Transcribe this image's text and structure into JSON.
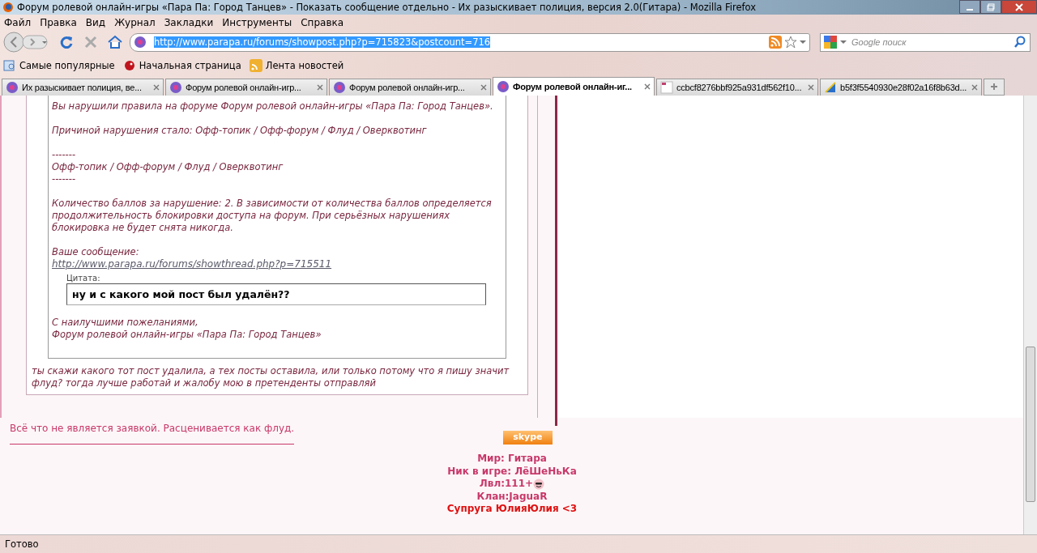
{
  "window": {
    "title": "Форум ролевой онлайн-игры «Пара Па: Город Танцев» - Показать сообщение отдельно - Их разыскивает полиция, версия 2.0(Гитара) - Mozilla Firefox"
  },
  "menu": [
    "Файл",
    "Правка",
    "Вид",
    "Журнал",
    "Закладки",
    "Инструменты",
    "Справка"
  ],
  "address": {
    "value": "http://www.parapa.ru/forums/showpost.php?p=715823&postcount=716"
  },
  "search": {
    "placeholder": "Google поиск"
  },
  "bookmarks": [
    {
      "label": "Самые популярные",
      "kind": "smart"
    },
    {
      "label": "Начальная страница",
      "kind": "home"
    },
    {
      "label": "Лента новостей",
      "kind": "feed"
    }
  ],
  "tabs": [
    {
      "label": "Их разыскивает полиция, ве...",
      "selected": false,
      "kind": "forum"
    },
    {
      "label": "Форум ролевой онлайн-игр...",
      "selected": false,
      "kind": "forum"
    },
    {
      "label": "Форум ролевой онлайн-игр...",
      "selected": false,
      "kind": "forum"
    },
    {
      "label": "Форум ролевой онлайн-иг...",
      "selected": true,
      "kind": "forum"
    },
    {
      "label": "ccbcf8276bbf925a931df562f10...",
      "selected": false,
      "kind": "image"
    },
    {
      "label": "b5f3f5540930e28f02a16f8b63d...",
      "selected": false,
      "kind": "file"
    }
  ],
  "notice": {
    "paragraphs": [
      [
        "Вы нарушили правила на форуме Форум ролевой онлайн-игры «Пара Па: Город Танцев»."
      ],
      [
        "Причиной нарушения стало: Офф-топик / Офф-форум / Флуд / Оверквотинг"
      ],
      [
        "-------",
        "Офф-топик / Офф-форум / Флуд / Оверквотинг",
        "-------"
      ],
      [
        "Количество баллов за нарушение: 2. В зависимости от количества баллов определяется продолжительность блокировки доступа на форум. При серьёзных нарушениях блокировка не будет снята никогда."
      ],
      [
        "Ваше сообщение:"
      ]
    ],
    "link": "http://www.parapa.ru/forums/showthread.php?p=715511",
    "quote_label": "Цитата:",
    "quote": "ну и с какого мой пост был удалён??",
    "closing": [
      "С наилучшими пожеланиями,",
      "Форум ролевой онлайн-игры «Пара Па: Город Танцев»"
    ]
  },
  "reply": "ты скажи какого тот пост удалила, а тех посты оставила, или только потому что я пишу значит флуд? тогда лучше работай и жалобу мою в претенденты отправляй",
  "rule": "Всё что не является заявкой. Расценивается как флуд.",
  "skype": "skype",
  "signature": [
    {
      "text": "Мир: Гитара",
      "color": "#c8386a",
      "smiley": false
    },
    {
      "text": "Ник в игре: ЛёШеНьКа",
      "color": "#c8386a",
      "smiley": false
    },
    {
      "text": "Лвл:111+",
      "color": "#c8386a",
      "smiley": true
    },
    {
      "text": "Клан:JaguaR",
      "color": "#c8386a",
      "smiley": false
    },
    {
      "text": "Супруга ЮлияЮлия <3",
      "color": "#e01010",
      "smiley": false
    }
  ],
  "status_bar": {
    "text": "Готово"
  }
}
